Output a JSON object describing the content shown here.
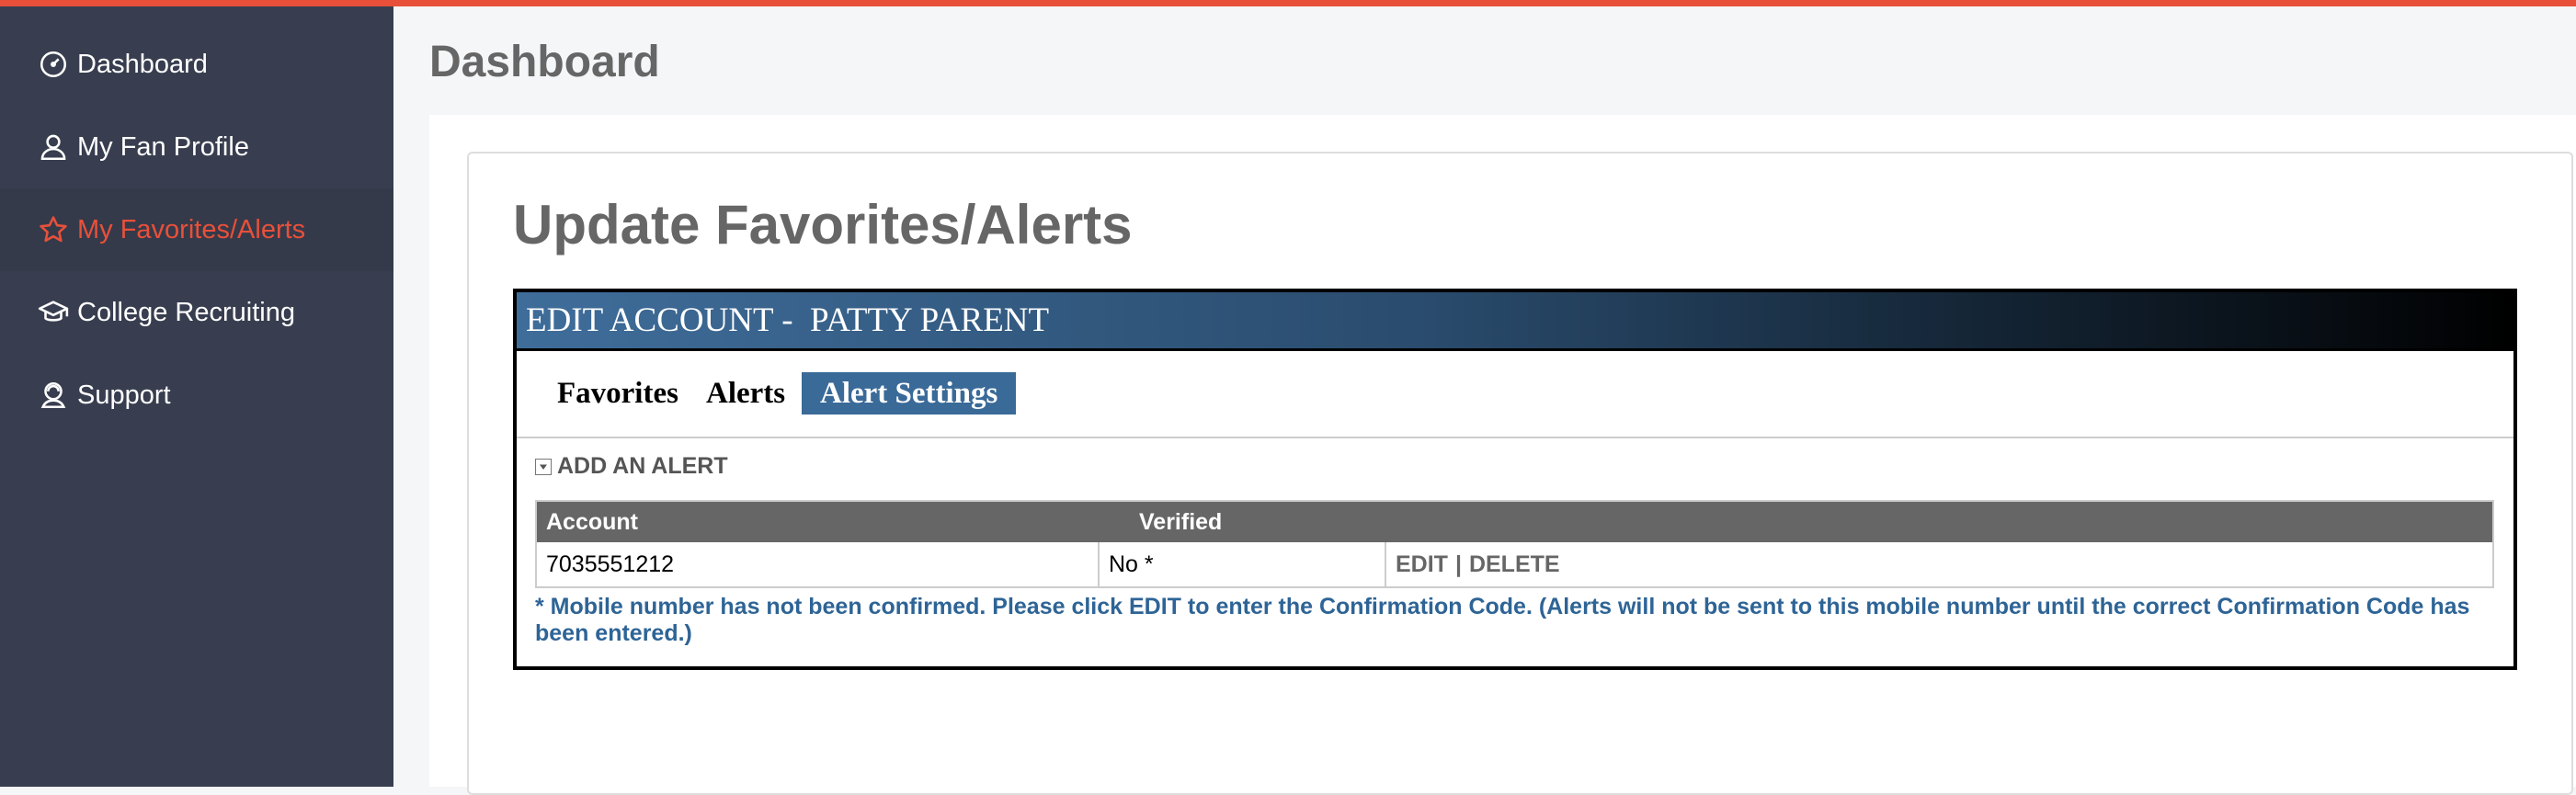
{
  "sidebar": {
    "items": [
      {
        "label": "Dashboard",
        "icon": "dashboard-icon"
      },
      {
        "label": "My Fan Profile",
        "icon": "user-icon"
      },
      {
        "label": "My Favorites/Alerts",
        "icon": "star-icon",
        "active": true
      },
      {
        "label": "College Recruiting",
        "icon": "graduation-cap-icon"
      },
      {
        "label": "Support",
        "icon": "support-icon"
      }
    ]
  },
  "header": {
    "title": "Dashboard"
  },
  "main": {
    "card_title": "Update Favorites/Alerts",
    "panel_title": "EDIT ACCOUNT -  PATTY PARENT",
    "tabs": [
      {
        "label": "Favorites"
      },
      {
        "label": "Alerts"
      },
      {
        "label": "Alert Settings",
        "active": true
      }
    ],
    "add_alert_label": "ADD AN ALERT",
    "table": {
      "columns": [
        "Account",
        "Verified"
      ],
      "rows": [
        {
          "account": "7035551212",
          "verified": "No *",
          "edit": "EDIT",
          "separator": "|",
          "delete": "DELETE"
        }
      ]
    },
    "note": "* Mobile number has not been confirmed. Please click EDIT to enter the Confirmation Code. (Alerts will not be sent to this mobile number until the correct Confirmation Code has been entered.)"
  },
  "colors": {
    "accent": "#e8503a",
    "sidebar_bg": "#383e4f",
    "tab_active": "#3a6a98",
    "note_text": "#2e6496"
  }
}
